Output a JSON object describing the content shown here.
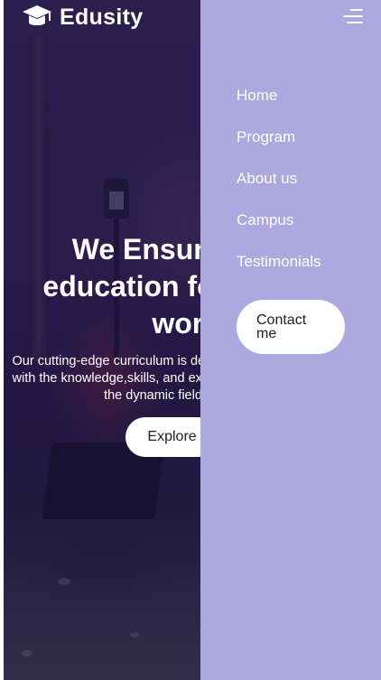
{
  "brand": {
    "name": "Edusity",
    "icon": "graduation-cap-icon"
  },
  "hero": {
    "title": "We Ensure better education for a better world",
    "description": "Our cutting-edge curriculum is designed to empower students with the knowledge,skills, and experiences needed to excel in the dynamic field of education",
    "cta_label": "Explore more"
  },
  "nav": {
    "items": [
      "Home",
      "Program",
      "About us",
      "Campus",
      "Testimonials"
    ],
    "contact_label": "Contact me",
    "menu_icon": "hamburger-menu-icon"
  },
  "colors": {
    "drawer": "#aba9e0",
    "overlay": "#190f46"
  }
}
